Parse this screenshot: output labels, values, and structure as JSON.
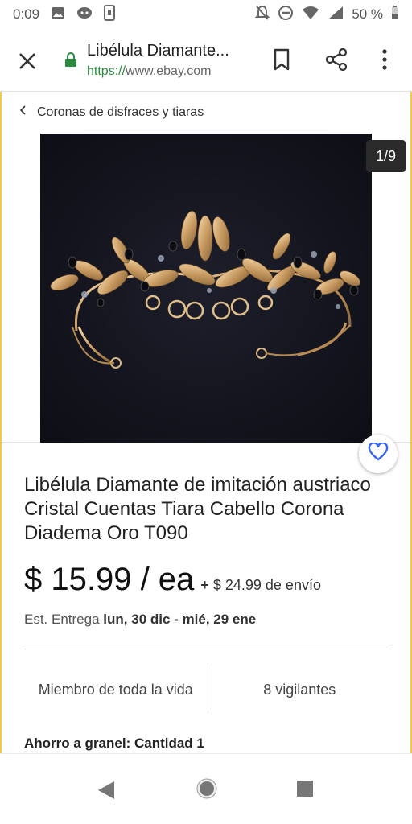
{
  "status_bar": {
    "time": "0:09",
    "battery": "50 %"
  },
  "browser": {
    "tab_title": "Libélula Diamante...",
    "url_scheme": "https://",
    "url_host": "www.ebay.com"
  },
  "breadcrumb": {
    "label": "Coronas de disfraces y tiaras"
  },
  "gallery": {
    "counter": "1/9"
  },
  "item": {
    "title": "Libélula Diamante de imitación austriaco Cristal Cuentas Tiara Cabello Corona Diadema Oro T090",
    "price": "$ 15.99 / ea",
    "shipping_prefix": "+",
    "shipping_amount": "$ 24.99",
    "shipping_suffix": "de envío",
    "delivery_label": "Est. Entrega",
    "delivery_dates": "lun, 30 dic - mié, 29 ene",
    "seller_stat": "Miembro de toda la vida",
    "watchers": "8 vigilantes",
    "bulk_savings": "Ahorro a granel: Cantidad 1"
  },
  "colors": {
    "accent_border": "#f2c94c",
    "lock_green": "#2b8a3e",
    "watch_blue": "#3665f3"
  }
}
